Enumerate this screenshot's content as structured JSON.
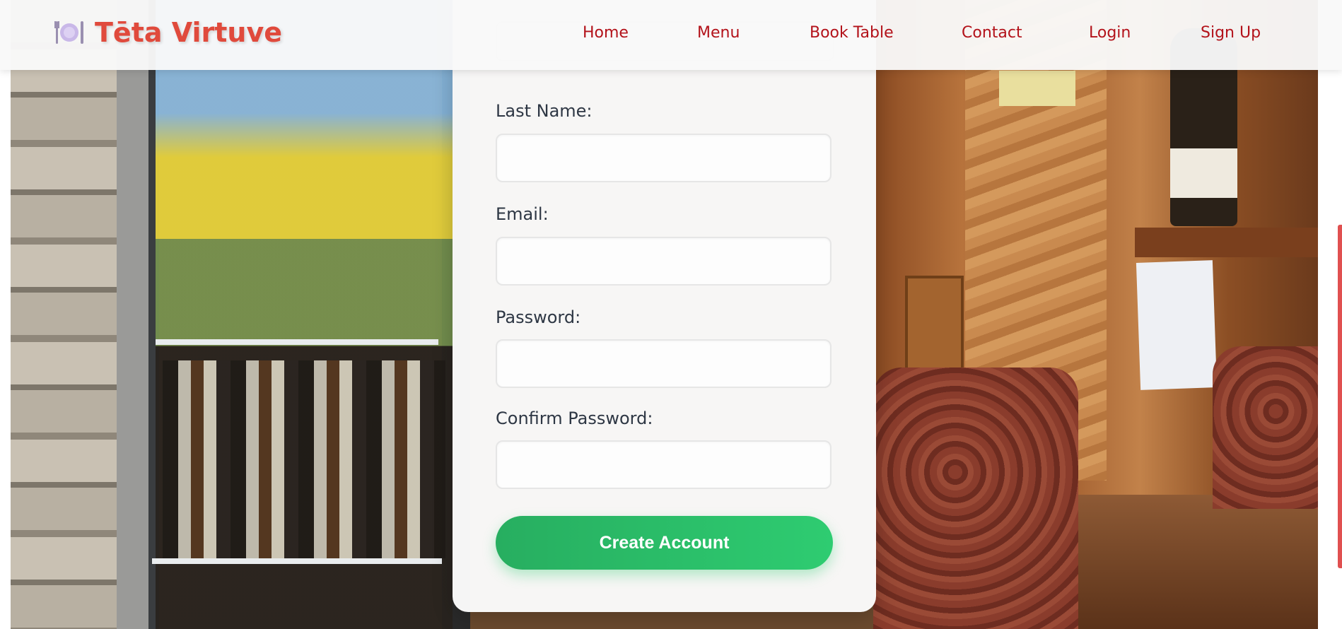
{
  "brand": {
    "name": "Tēta Virtuve",
    "icon": "plate-fork-knife-icon"
  },
  "nav": {
    "home": "Home",
    "menu": "Menu",
    "book_table": "Book Table",
    "contact": "Contact",
    "login": "Login",
    "signup": "Sign Up"
  },
  "form": {
    "last_name_label": "Last Name:",
    "last_name_value": "",
    "email_label": "Email:",
    "email_value": "",
    "password_label": "Password:",
    "password_value": "",
    "confirm_password_label": "Confirm Password:",
    "confirm_password_value": "",
    "submit_label": "Create Account"
  },
  "colors": {
    "brand": "#e04a3c",
    "nav_link": "#b3121a",
    "button": "#2ecc71"
  }
}
